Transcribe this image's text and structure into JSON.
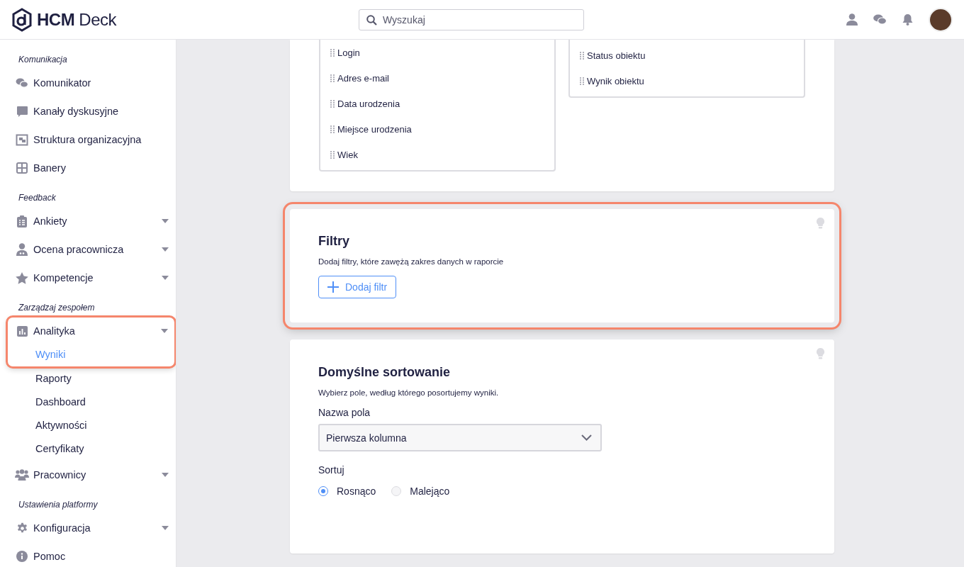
{
  "header": {
    "logo": "**HCM** Deck",
    "search": {
      "placeholder": "Wyszukaj"
    }
  },
  "sidebar": {
    "sections": [
      {
        "label": "Komunikacja",
        "items": [
          {
            "label": "Komunikator",
            "has_submenu": false,
            "highlighted": false
          },
          {
            "label": "Kanały dyskusyjne",
            "has_submenu": false,
            "highlighted": false
          },
          {
            "label": "Struktura organizacyjna",
            "has_submenu": false,
            "highlighted": false
          },
          {
            "label": "Banery",
            "has_submenu": false,
            "highlighted": false
          }
        ]
      },
      {
        "label": "Feedback",
        "items": [
          {
            "label": "Ankiety",
            "has_submenu": true,
            "highlighted": false
          },
          {
            "label": "Ocena pracownicza",
            "has_submenu": true,
            "highlighted": false
          },
          {
            "label": "Kompetencje",
            "has_submenu": true,
            "highlighted": false
          }
        ]
      },
      {
        "label": "Zarządzaj zespołem",
        "items": [
          {
            "label": "Analityka",
            "has_submenu": true,
            "highlighted": true,
            "children": [
              {
                "label": "Wyniki",
                "selected": true
              },
              {
                "label": "Raporty",
                "selected": false
              },
              {
                "label": "Dashboard",
                "selected": false
              },
              {
                "label": "Aktywności",
                "selected": false
              },
              {
                "label": "Certyfikaty",
                "selected": false
              }
            ]
          },
          {
            "label": "Pracownicy",
            "has_submenu": true,
            "highlighted": false
          }
        ]
      },
      {
        "label": "Ustawienia platformy",
        "items": [
          {
            "label": "Konfiguracja",
            "has_submenu": true,
            "highlighted": false
          },
          {
            "label": "Pomoc",
            "has_submenu": false,
            "highlighted": false
          }
        ]
      }
    ]
  },
  "columns_card": {
    "left_fields": [
      "Login",
      "Adres e-mail",
      "Data urodzenia",
      "Miejsce urodzenia",
      "Wiek"
    ],
    "right_fields": [
      "Status obiektu",
      "Wynik obiektu"
    ]
  },
  "filters_card": {
    "title": "Filtry",
    "description": "Dodaj filtry, które zawężą zakres danych w raporcie",
    "button": "Dodaj filtr",
    "highlighted": true
  },
  "sort_card": {
    "title": "Domyślne sortowanie",
    "description": "Wybierz pole, według którego posortujemy wyniki.",
    "field_label": "Nazwa pola",
    "field_value": "Pierwsza kolumna",
    "sort_label": "Sortuj",
    "options": [
      {
        "label": "Rosnąco",
        "selected": true
      },
      {
        "label": "Malejąco",
        "selected": false
      }
    ],
    "highlighted": false
  }
}
